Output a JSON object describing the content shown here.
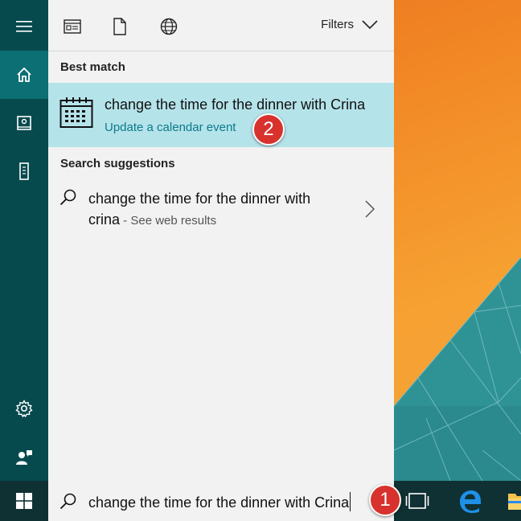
{
  "toolbar": {
    "filters_label": "Filters",
    "icons": [
      "apps-icon",
      "document-icon",
      "globe-icon"
    ]
  },
  "best_match": {
    "heading": "Best match",
    "title": "change the time for the dinner with Crina",
    "subtitle": "Update a calendar event",
    "icon": "calendar-icon"
  },
  "suggestions": {
    "heading": "Search suggestions",
    "items": [
      {
        "text": "change the time for the dinner with crina",
        "suffix": " - See web results",
        "icon": "search-icon"
      }
    ]
  },
  "search": {
    "value": "change the time for the dinner with Crina",
    "icon": "search-icon"
  },
  "sidebar": {
    "items": [
      "menu-icon",
      "home-icon",
      "notebook-icon",
      "device-icon",
      "settings-icon",
      "feedback-icon"
    ]
  },
  "annotations": [
    "1",
    "2"
  ],
  "colors": {
    "rail": "#074a4e",
    "rail_active": "#0c6f74",
    "panel": "#f2f2f2",
    "highlight": "#b5e3ea",
    "accent_text": "#0b7a8a",
    "badge": "#d7322d",
    "taskbar": "#0f3133"
  }
}
